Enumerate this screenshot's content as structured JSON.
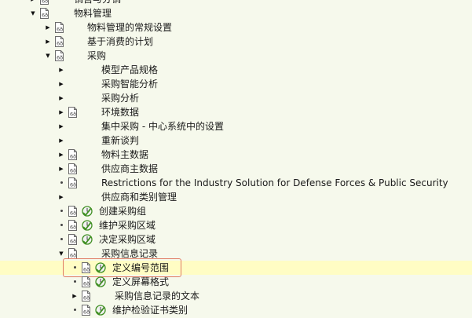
{
  "window": {
    "title": ""
  },
  "tree": {
    "selected_index": 19,
    "rows": [
      {
        "label": "销售与分销",
        "level": 0,
        "node": "collapsed",
        "doc": true,
        "clock": false
      },
      {
        "label": "物料管理",
        "level": 0,
        "node": "expanded",
        "doc": true,
        "clock": false
      },
      {
        "label": "物料管理的常规设置",
        "level": 1,
        "node": "collapsed",
        "doc": true,
        "clock": false
      },
      {
        "label": "基于消费的计划",
        "level": 1,
        "node": "collapsed",
        "doc": true,
        "clock": false
      },
      {
        "label": "采购",
        "level": 1,
        "node": "expanded",
        "doc": true,
        "clock": false
      },
      {
        "label": "模型产品规格",
        "level": 2,
        "node": "collapsed",
        "doc": false,
        "clock": false
      },
      {
        "label": "采购智能分析",
        "level": 2,
        "node": "collapsed",
        "doc": false,
        "clock": false
      },
      {
        "label": "采购分析",
        "level": 2,
        "node": "collapsed",
        "doc": false,
        "clock": false
      },
      {
        "label": "环境数据",
        "level": 2,
        "node": "collapsed",
        "doc": true,
        "clock": false
      },
      {
        "label": "集中采购 - 中心系统中的设置",
        "level": 2,
        "node": "collapsed",
        "doc": false,
        "clock": false
      },
      {
        "label": "重新谈判",
        "level": 2,
        "node": "collapsed",
        "doc": false,
        "clock": false
      },
      {
        "label": "物料主数据",
        "level": 2,
        "node": "collapsed",
        "doc": true,
        "clock": false
      },
      {
        "label": "供应商主数据",
        "level": 2,
        "node": "collapsed",
        "doc": true,
        "clock": false
      },
      {
        "label": "Restrictions for the Industry Solution for Defense Forces & Public Security",
        "level": 2,
        "node": "leaf",
        "doc": true,
        "clock": false
      },
      {
        "label": "供应商和类别管理",
        "level": 2,
        "node": "collapsed",
        "doc": false,
        "clock": false
      },
      {
        "label": "创建采购组",
        "level": 2,
        "node": "leaf",
        "doc": true,
        "clock": true
      },
      {
        "label": "维护采购区域",
        "level": 2,
        "node": "leaf",
        "doc": true,
        "clock": true
      },
      {
        "label": "决定采购区域",
        "level": 2,
        "node": "leaf",
        "doc": true,
        "clock": true
      },
      {
        "label": "采购信息记录",
        "level": 2,
        "node": "expanded",
        "doc": true,
        "clock": false
      },
      {
        "label": "定义编号范围",
        "level": 3,
        "node": "leaf",
        "doc": true,
        "clock": true
      },
      {
        "label": "定义屏幕格式",
        "level": 3,
        "node": "leaf",
        "doc": true,
        "clock": true
      },
      {
        "label": "采购信息记录的文本",
        "level": 3,
        "node": "collapsed",
        "doc": true,
        "clock": false
      },
      {
        "label": "维护检验证书类别",
        "level": 3,
        "node": "leaf",
        "doc": true,
        "clock": true
      }
    ]
  },
  "colors": {
    "background": "#f6f9ec",
    "selected_row": "#fffdc4",
    "highlight_border": "#e07b63",
    "clock_green": "#3f8f22"
  },
  "icons": {
    "document": "document-icon",
    "execute": "clock-execute-icon",
    "expanded": "triangle-down-icon",
    "collapsed": "triangle-right-icon"
  }
}
